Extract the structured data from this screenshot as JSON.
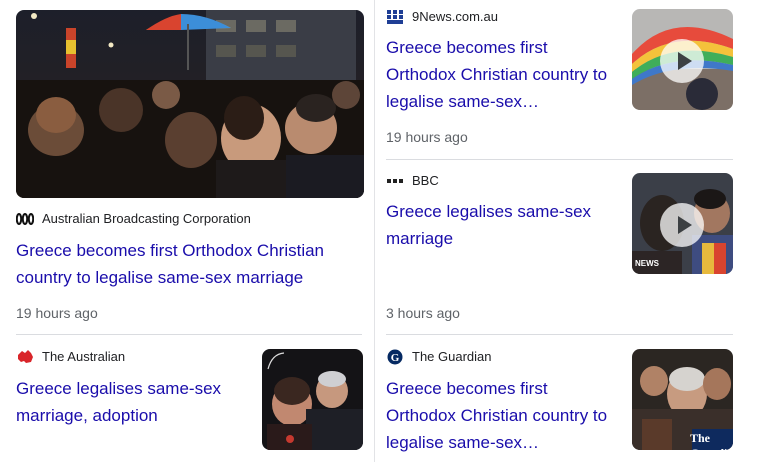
{
  "articles": [
    {
      "source": "Australian Broadcasting Corporation",
      "source_icon": "abc-logo-icon",
      "headline": "Greece becomes first Orthodox Christian country to legalise same-sex marriage",
      "time": "19 hours ago",
      "image": "crowd-celebration-night-photo"
    },
    {
      "source": "9News.com.au",
      "source_icon": "9news-logo-icon",
      "headline": "Greece becomes first Orthodox Christian country to legalise same-sex…",
      "time": "19 hours ago",
      "image": "rainbow-umbrella-video-thumbnail"
    },
    {
      "source": "BBC",
      "source_icon": "bbc-logo-icon",
      "headline": "Greece legalises same-sex marriage",
      "time": "3 hours ago",
      "image": "couple-video-thumbnail",
      "overlay_label": "NEWS"
    },
    {
      "source": "The Australian",
      "source_icon": "australia-map-icon",
      "headline": "Greece legalises same-sex marriage, adoption",
      "image": "two-women-embrace-photo"
    },
    {
      "source": "The Guardian",
      "source_icon": "guardian-logo-icon",
      "headline": "Greece becomes first Orthodox Christian country to legalise same-sex…",
      "image": "crowd-embrace-photo",
      "overlay_label": "The Guardi"
    }
  ],
  "colors": {
    "headline": "#1a0dab",
    "meta": "#5f6368",
    "divider": "#dadce0"
  }
}
